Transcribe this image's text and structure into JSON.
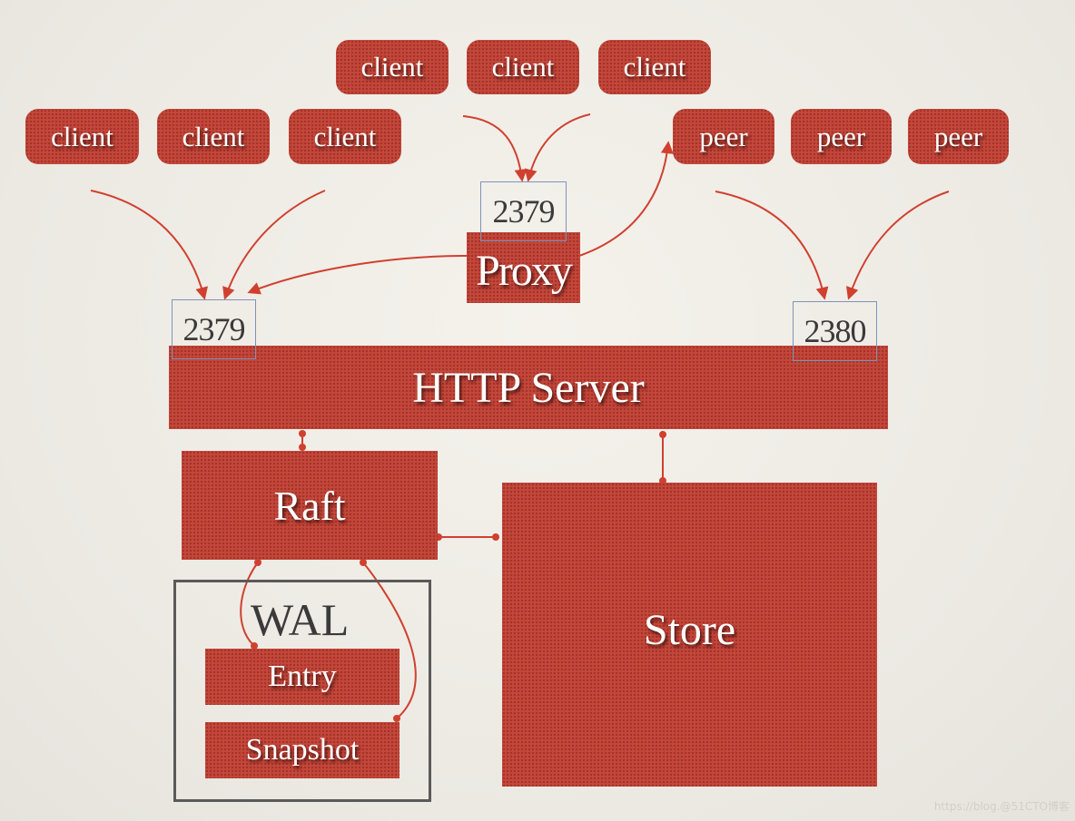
{
  "diagram": {
    "colors": {
      "box_fill": "#c4473a",
      "arrow": "#d0402f",
      "port_border": "#7e93b8",
      "wal_border": "#5a5a5a",
      "background": "#f2efe9"
    },
    "clients_top": [
      "client",
      "client",
      "client"
    ],
    "clients_left": [
      "client",
      "client",
      "client"
    ],
    "peers": [
      "peer",
      "peer",
      "peer"
    ],
    "proxy": {
      "label": "Proxy",
      "port": "2379"
    },
    "http_server": {
      "label": "HTTP Server",
      "client_port": "2379",
      "peer_port": "2380"
    },
    "raft": {
      "label": "Raft"
    },
    "store": {
      "label": "Store"
    },
    "wal": {
      "label": "WAL",
      "entry": "Entry",
      "snapshot": "Snapshot"
    },
    "watermark": "https://blog.@51CTO博客"
  }
}
